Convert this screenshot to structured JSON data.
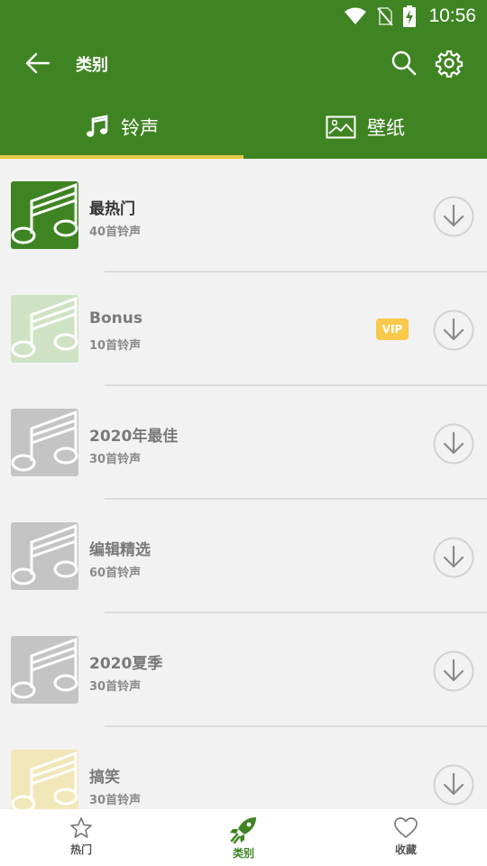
{
  "status_bar": {
    "time": "10:56"
  },
  "app_bar": {
    "title": "类别"
  },
  "tabs": [
    {
      "label": "铃声",
      "icon": "music-note-icon",
      "active": true
    },
    {
      "label": "壁纸",
      "icon": "image-icon",
      "active": false
    }
  ],
  "colors": {
    "primary": "#3f8423",
    "indicator": "#e5c84a",
    "vip": "#f8c94a"
  },
  "categories": [
    {
      "title": "最热门",
      "count": "40首铃声",
      "thumb_color": "#3f8423"
    },
    {
      "title": "Bonus",
      "count": "10首铃声",
      "thumb_color": "#cfe3c4",
      "badge": "VIP"
    },
    {
      "title": "2020年最佳",
      "count": "30首铃声",
      "thumb_color": "#c4c4c4"
    },
    {
      "title": "编辑精选",
      "count": "60首铃声",
      "thumb_color": "#c4c4c4"
    },
    {
      "title": "2020夏季",
      "count": "30首铃声",
      "thumb_color": "#c4c4c4"
    },
    {
      "title": "搞笑",
      "count": "30首铃声",
      "thumb_color": "#f2e7b8"
    }
  ],
  "bottom_nav": [
    {
      "label": "热门",
      "icon": "star-icon",
      "active": false
    },
    {
      "label": "类别",
      "icon": "rocket-icon",
      "active": true
    },
    {
      "label": "收藏",
      "icon": "heart-icon",
      "active": false
    }
  ]
}
